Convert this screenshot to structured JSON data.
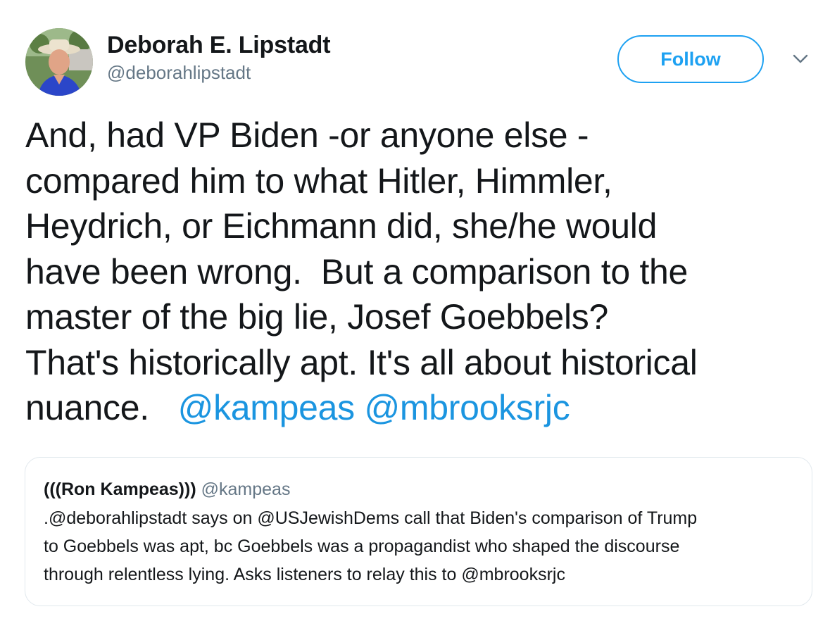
{
  "author": {
    "display_name": "Deborah E. Lipstadt",
    "handle": "@deborahlipstadt"
  },
  "follow_label": "Follow",
  "tweet": {
    "lines": [
      "And, had VP Biden -or anyone else -",
      "compared him to what Hitler, Himmler,",
      "Heydrich, or Eichmann did, she/he would",
      "have been wrong.  But a comparison to the",
      "master of the big lie, Josef Goebbels?",
      "That's historically apt. It's all about historical"
    ],
    "last_line_text": "nuance.   ",
    "mention_1": "@kampeas",
    "mention_2": "@mbrooksrjc"
  },
  "quoted_tweet": {
    "display_name": "(((Ron Kampeas)))",
    "handle": "@kampeas",
    "lines": [
      ".@deborahlipstadt says on @USJewishDems call that Biden's comparison of Trump",
      "to Goebbels was apt, bc Goebbels was a propagandist who shaped the discourse",
      "through relentless lying. Asks listeners to relay this to @mbrooksrjc"
    ]
  },
  "colors": {
    "link_blue": "#1b95e0",
    "follow_blue": "#1da1f2",
    "secondary_gray": "#657786",
    "border_gray": "#e1e8ed"
  },
  "icons": {
    "caret": "chevron-down-icon"
  }
}
